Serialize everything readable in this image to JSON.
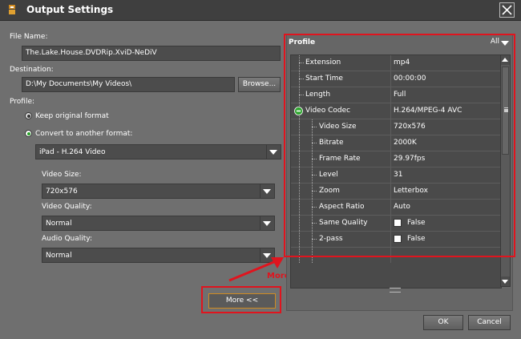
{
  "window": {
    "title": "Output Settings"
  },
  "file_name": {
    "label": "File Name:",
    "value": "The.Lake.House.DVDRip.XviD-NeDiV"
  },
  "destination": {
    "label": "Destination:",
    "value": "D:\\My Documents\\My Videos\\",
    "browse_label": "Browse..."
  },
  "profile_section": {
    "label": "Profile:",
    "keep_original": "Keep original format",
    "convert": "Convert to another format:",
    "format_value": "iPad - H.264 Video",
    "video_size_label": "Video Size:",
    "video_size_value": "720x576",
    "video_quality_label": "Video Quality:",
    "video_quality_value": "Normal",
    "audio_quality_label": "Audio Quality:",
    "audio_quality_value": "Normal"
  },
  "more_button": {
    "label": "More <<"
  },
  "annotation": {
    "text": "More Profile Settings"
  },
  "panel": {
    "title": "Profile",
    "filter": "All",
    "rows": [
      {
        "key": "Extension",
        "value": "mp4"
      },
      {
        "key": "Start Time",
        "value": "00:00:00"
      },
      {
        "key": "Length",
        "value": "Full"
      },
      {
        "key": "Video Codec",
        "value": "H.264/MPEG-4 AVC"
      },
      {
        "key": "Video Size",
        "value": "720x576"
      },
      {
        "key": "Bitrate",
        "value": "2000K"
      },
      {
        "key": "Frame Rate",
        "value": "29.97fps"
      },
      {
        "key": "Level",
        "value": "31"
      },
      {
        "key": "Zoom",
        "value": "Letterbox"
      },
      {
        "key": "Aspect Ratio",
        "value": "Auto"
      },
      {
        "key": "Same Quality",
        "value": "False"
      },
      {
        "key": "2-pass",
        "value": "False"
      }
    ]
  },
  "buttons": {
    "ok": "OK",
    "cancel": "Cancel"
  },
  "colors": {
    "annotation_red": "#e0141e",
    "background": "#6f6f6f",
    "titlebar": "#3f3f3f"
  }
}
